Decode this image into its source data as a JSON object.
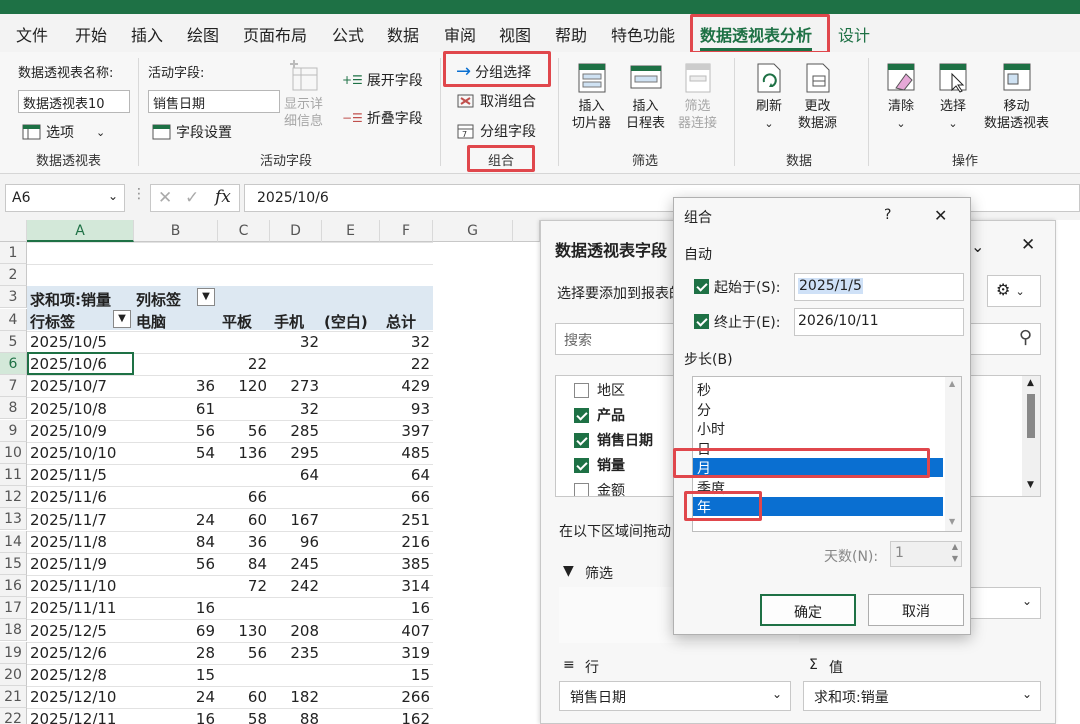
{
  "menu": {
    "tabs": [
      "文件",
      "开始",
      "插入",
      "绘图",
      "页面布局",
      "公式",
      "数据",
      "审阅",
      "视图",
      "帮助",
      "特色功能",
      "数据透视表分析",
      "设计"
    ],
    "active": "数据透视表分析"
  },
  "ribbon": {
    "pivot": {
      "name_label": "数据透视表名称:",
      "name_value": "数据透视表10",
      "options": "选项",
      "group": "数据透视表"
    },
    "active_field": {
      "label": "活动字段:",
      "value": "销售日期",
      "settings": "字段设置",
      "drill": "显示详\n细信息",
      "expand": "展开字段",
      "collapse": "折叠字段",
      "group": "活动字段"
    },
    "grouping": {
      "select": "分组选择",
      "ungroup": "取消组合",
      "field": "分组字段",
      "group": "组合"
    },
    "filter": {
      "slicer": "插入\n切片器",
      "timeline": "插入\n日程表",
      "conn": "筛选\n器连接",
      "group": "筛选"
    },
    "data": {
      "refresh": "刷新",
      "change": "更改\n数据源",
      "group": "数据"
    },
    "actions": {
      "clear": "清除",
      "select": "选择",
      "move": "移动\n数据透视表",
      "group": "操作"
    }
  },
  "formula_bar": {
    "cell_ref": "A6",
    "fx": "fx",
    "value": "2025/10/6"
  },
  "sheet": {
    "columns": [
      "A",
      "B",
      "C",
      "D",
      "E",
      "F",
      "G"
    ],
    "row_numbers": [
      "1",
      "2",
      "3",
      "4",
      "5",
      "6",
      "7",
      "8",
      "9",
      "10",
      "11",
      "12",
      "13",
      "14",
      "15",
      "16",
      "17",
      "18",
      "19",
      "20",
      "21",
      "22"
    ],
    "header_row3": {
      "sum_label": "求和项:销量",
      "col_label": "列标签"
    },
    "header_row4": {
      "row_label": "行标签",
      "c1": "电脑",
      "c2": "平板",
      "c3": "手机",
      "c4": "(空白)",
      "c5": "总计"
    },
    "rows": [
      {
        "date": "2025/10/5",
        "b": "",
        "c": "",
        "d": "32",
        "f": "32"
      },
      {
        "date": "2025/10/6",
        "b": "",
        "c": "22",
        "d": "",
        "f": "22"
      },
      {
        "date": "2025/10/7",
        "b": "36",
        "c": "120",
        "d": "273",
        "f": "429"
      },
      {
        "date": "2025/10/8",
        "b": "61",
        "c": "",
        "d": "32",
        "f": "93"
      },
      {
        "date": "2025/10/9",
        "b": "56",
        "c": "56",
        "d": "285",
        "f": "397"
      },
      {
        "date": "2025/10/10",
        "b": "54",
        "c": "136",
        "d": "295",
        "f": "485"
      },
      {
        "date": "2025/11/5",
        "b": "",
        "c": "",
        "d": "64",
        "f": "64"
      },
      {
        "date": "2025/11/6",
        "b": "",
        "c": "66",
        "d": "",
        "f": "66"
      },
      {
        "date": "2025/11/7",
        "b": "24",
        "c": "60",
        "d": "167",
        "f": "251"
      },
      {
        "date": "2025/11/8",
        "b": "84",
        "c": "36",
        "d": "96",
        "f": "216"
      },
      {
        "date": "2025/11/9",
        "b": "56",
        "c": "84",
        "d": "245",
        "f": "385"
      },
      {
        "date": "2025/11/10",
        "b": "",
        "c": "72",
        "d": "242",
        "f": "314"
      },
      {
        "date": "2025/11/11",
        "b": "16",
        "c": "",
        "d": "",
        "f": "16"
      },
      {
        "date": "2025/12/5",
        "b": "69",
        "c": "130",
        "d": "208",
        "f": "407"
      },
      {
        "date": "2025/12/6",
        "b": "28",
        "c": "56",
        "d": "235",
        "f": "319"
      },
      {
        "date": "2025/12/8",
        "b": "15",
        "c": "",
        "d": "",
        "f": "15"
      },
      {
        "date": "2025/12/10",
        "b": "24",
        "c": "60",
        "d": "182",
        "f": "266"
      },
      {
        "date": "2025/12/11",
        "b": "16",
        "c": "58",
        "d": "88",
        "f": "162"
      }
    ]
  },
  "field_pane": {
    "title": "数据透视表字段",
    "subtitle": "选择要添加到报表的",
    "search_placeholder": "搜索",
    "fields": [
      {
        "name": "地区",
        "checked": false
      },
      {
        "name": "产品",
        "checked": true
      },
      {
        "name": "销售日期",
        "checked": true
      },
      {
        "name": "销量",
        "checked": true
      },
      {
        "name": "金额",
        "checked": false
      }
    ],
    "drag_hint": "在以下区域间拖动",
    "filter_label": "筛选",
    "rows_label": "行",
    "values_label": "值",
    "row_field": "销售日期",
    "value_field": "求和项:销量"
  },
  "dialog": {
    "title": "组合",
    "help": "?",
    "close": "✕",
    "auto_label": "自动",
    "start_label": "起始于(S):",
    "start_value": "2025/1/5",
    "end_label": "终止于(E):",
    "end_value": "2026/10/11",
    "step_label": "步长(B)",
    "steps": [
      "秒",
      "分",
      "小时",
      "日",
      "月",
      "季度",
      "年"
    ],
    "selected_steps": [
      "月",
      "年"
    ],
    "days_label": "天数(N):",
    "days_value": "1",
    "ok": "确定",
    "cancel": "取消"
  },
  "colors": {
    "accent": "#1e7145",
    "highlight": "#e0474c",
    "selection": "#0a6fd1"
  }
}
